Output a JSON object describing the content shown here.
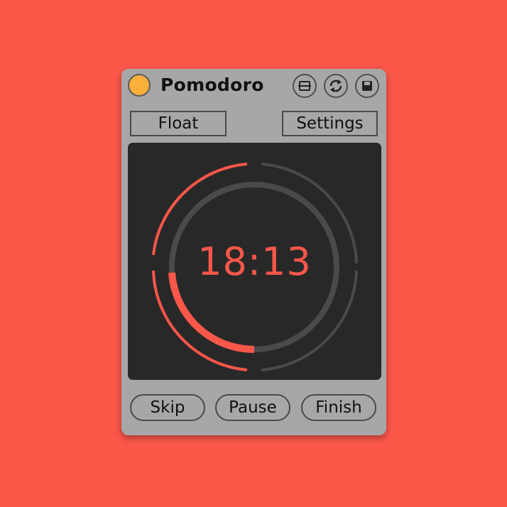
{
  "app": {
    "title": "Pomodoro"
  },
  "header": {
    "power_icon": "power-led-icon",
    "icons": [
      "float-window-icon",
      "sync-icon",
      "save-icon"
    ]
  },
  "toolbar": {
    "float_label": "Float",
    "settings_label": "Settings"
  },
  "timer": {
    "display": "18:13",
    "progress_fraction": 0.25,
    "elapsed_fraction": 0.45
  },
  "controls": {
    "skip_label": "Skip",
    "pause_label": "Pause",
    "finish_label": "Finish"
  },
  "colors": {
    "background": "#fd574a",
    "accent": "#fd574a",
    "panel": "#a7a7a7",
    "screen": "#282828",
    "led": "#fbb03b",
    "track": "#4a4a4a"
  }
}
